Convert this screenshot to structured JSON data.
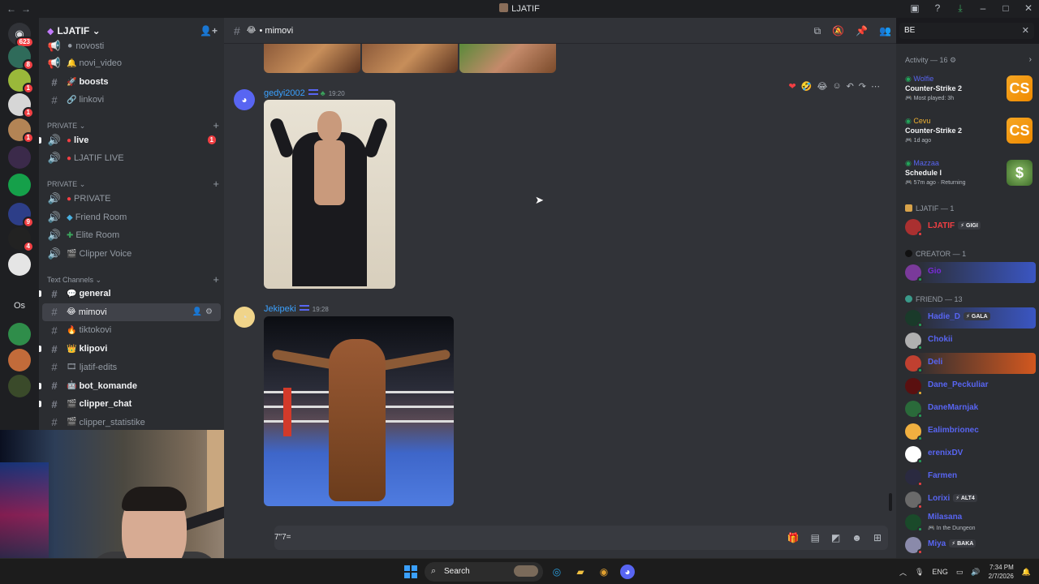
{
  "titlebar": {
    "title": "LJATIF"
  },
  "rail": {
    "home_badge": "623",
    "servers": [
      {
        "name": "server-1",
        "badge": "8",
        "color": "#2f6b5a"
      },
      {
        "name": "server-2",
        "badge": "1",
        "color": "#9ab83a"
      },
      {
        "name": "server-3",
        "badge": "1",
        "color": "#d6d6d6"
      },
      {
        "name": "server-4",
        "badge": "1",
        "color": "#b38455"
      },
      {
        "name": "server-5",
        "badge": "",
        "color": "#3b2a4a"
      },
      {
        "name": "server-6",
        "badge": "",
        "color": "#15a04a"
      },
      {
        "name": "server-7",
        "badge": "9",
        "color": "#2d3e88"
      },
      {
        "name": "server-8",
        "badge": "4",
        "color": "#222"
      },
      {
        "name": "server-9",
        "badge": "",
        "color": "#e5e5e5"
      }
    ],
    "folder_label": "Os"
  },
  "sidebar": {
    "server_name": "LJATIF",
    "channels_top": [
      {
        "label": "novosti",
        "type": "voice",
        "emoji": "⚫"
      },
      {
        "label": "novi_video",
        "type": "voice",
        "emoji": "🔔"
      },
      {
        "label": "boosts",
        "type": "text",
        "emoji": "🚀",
        "bold": true
      },
      {
        "label": "linkovi",
        "type": "text",
        "emoji": "🔗"
      }
    ],
    "cat_private_1": "PRIVATE",
    "ch_live": "live",
    "ch_live_count": "1",
    "ch_ljatif_live": "LJATIF LIVE",
    "cat_private_2": "PRIVATE",
    "ch_private": "PRIVATE",
    "ch_friend_room": "Friend Room",
    "ch_elite_room": "Elite Room",
    "ch_clipper_voice": "Clipper Voice",
    "cat_text": "Text Channels",
    "text_channels": [
      {
        "label": "general",
        "bold": true,
        "emoji": "💬"
      },
      {
        "label": "mimovi",
        "active": true,
        "emoji": "😂"
      },
      {
        "label": "tiktokovi",
        "emoji": "🔥"
      },
      {
        "label": "klipovi",
        "bold": true,
        "emoji": "👑"
      },
      {
        "label": "ljatif-edits",
        "emoji": "🎞"
      },
      {
        "label": "bot_komande",
        "bold": true,
        "emoji": "🤖"
      },
      {
        "label": "clipper_chat",
        "bold": true,
        "emoji": "🎬"
      },
      {
        "label": "clipper_statistike",
        "emoji": "🎬"
      }
    ]
  },
  "chat": {
    "channel_name": "mimovi",
    "messages": [
      {
        "author": "gedyi2002",
        "time": "19:20",
        "color": "#3ba1ff"
      },
      {
        "author": "Jekipeki",
        "time": "19:28",
        "color": "#3ba1ff"
      }
    ],
    "composer_text": "7\"7="
  },
  "search": {
    "value": "BE"
  },
  "members": {
    "activity_header": "Activity — 16",
    "activities": [
      {
        "user": "Wolfie",
        "game": "Counter-Strike 2",
        "sub": "Most played: 3h",
        "user_color": "#5865f2",
        "icon": "CS"
      },
      {
        "user": "Cevu",
        "game": "Counter-Strike 2",
        "sub": "1d ago",
        "user_color": "#f0b232",
        "icon": "CS"
      },
      {
        "user": "Mazzaa",
        "game": "Schedule I",
        "sub": "57m ago · Returning",
        "user_color": "#5865f2",
        "icon": "$"
      }
    ],
    "group_ljatif": "LJATIF — 1",
    "owner": {
      "name": "LJATIF",
      "chip": "GIGI"
    },
    "group_creator": "CREATOR — 1",
    "creator": {
      "name": "Gio"
    },
    "group_friend": "FRIEND — 13",
    "friends": [
      {
        "name": "Hadie_D",
        "chip": "GALA",
        "banner": "blue"
      },
      {
        "name": "Chokii",
        "chip": ""
      },
      {
        "name": "Deli",
        "chip": "",
        "banner": "fire"
      },
      {
        "name": "Dane_Peckuliar",
        "chip": ""
      },
      {
        "name": "DaneMarnjak",
        "chip": ""
      },
      {
        "name": "Ealimbrionec",
        "chip": ""
      },
      {
        "name": "erenixDV",
        "chip": ""
      },
      {
        "name": "Farmen",
        "chip": ""
      },
      {
        "name": "Lorixi",
        "chip": "ALT4"
      },
      {
        "name": "Milasana",
        "chip": "",
        "status": "In the Dungeon"
      },
      {
        "name": "Miya",
        "chip": "BAKA"
      }
    ]
  },
  "taskbar": {
    "search_label": "Search",
    "lang": "ENG",
    "time": "7:34 PM",
    "date": "2/7/2026"
  }
}
